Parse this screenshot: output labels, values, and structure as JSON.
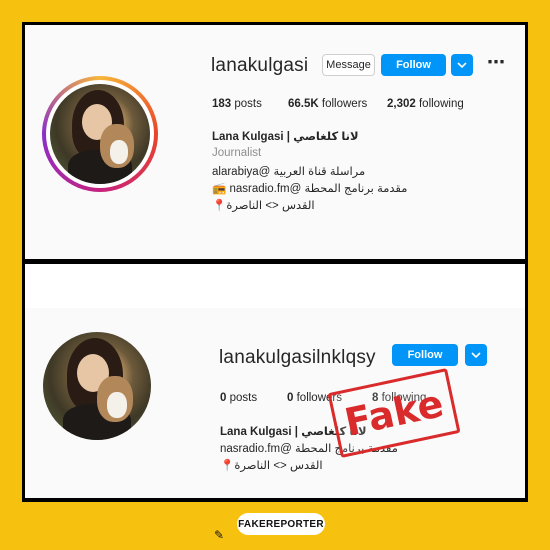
{
  "real_profile": {
    "username": "lanakulgasi",
    "message_label": "Message",
    "follow_label": "Follow",
    "more_icon": "⋯",
    "posts": "183",
    "posts_label": "posts",
    "followers": "66.5K",
    "followers_label": "followers",
    "following": "2,302",
    "following_label": "following",
    "display_name": "Lana Kulgasi | لانا كلغاصي",
    "category": "Journalist",
    "bio_line1": "مراسلة قناة العربية @alarabiya",
    "bio_line2": "مقدمة برنامج المحطة @nasradio.fm 📻",
    "bio_line3": "القدس <> الناصرة📍"
  },
  "fake_profile": {
    "username": "lanakulgasilnklqsy",
    "follow_label": "Follow",
    "posts": "0",
    "posts_label": "posts",
    "followers": "0",
    "followers_label": "followers",
    "following": "8",
    "following_label": "following",
    "display_name": "Lana Kulgasi | لانا كلغاصي",
    "bio_line1": "مقدمة برنامج المحطة @nasradio.fm",
    "bio_line2": "القدس <> الناصرة📍"
  },
  "stamp_text": "Fake",
  "footer": {
    "brand": "FAKEREPORTER"
  },
  "colors": {
    "background": "#f6c10f",
    "follow_blue": "#0095f6",
    "stamp_red": "#d92b2b"
  }
}
